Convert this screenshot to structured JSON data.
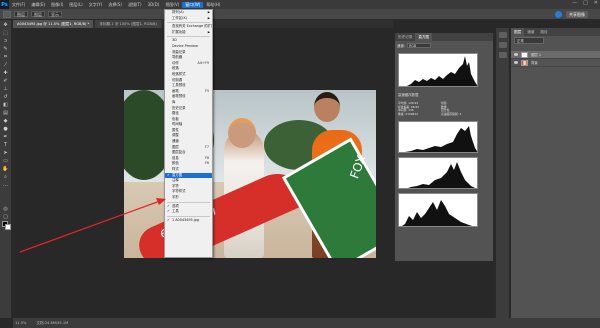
{
  "app": {
    "logo": "Ps",
    "menu_items": [
      "文件(F)",
      "编辑(E)",
      "图像(I)",
      "图层(L)",
      "文字(Y)",
      "选择(S)",
      "滤镜(T)",
      "3D(D)",
      "视图(V)",
      "窗口(W)",
      "帮助(H)"
    ],
    "active_menu_index": 9,
    "window_controls": [
      "—",
      "□",
      "✕"
    ]
  },
  "options_bar": {
    "fields": [
      "图层",
      "图层",
      "显示"
    ],
    "share_label": "共享图像"
  },
  "tabs": [
    {
      "label": "A0043495.jpg @ 11.5% (图层1, RGB/8) *",
      "active": true
    },
    {
      "label": "未标题-1 @ 100% (图层1, RGB/8)",
      "active": false
    }
  ],
  "window_menu": {
    "items": [
      {
        "label": "排列(A)",
        "submenu": true
      },
      {
        "label": "工作区(K)",
        "submenu": true
      },
      {
        "sep": true
      },
      {
        "label": "查找有关 Exchange 的扩展功能...",
        "submenu": false
      },
      {
        "label": "扩展功能",
        "submenu": true
      },
      {
        "sep": true
      },
      {
        "label": "3D",
        "submenu": false
      },
      {
        "label": "Device Preview",
        "submenu": false
      },
      {
        "label": "测量记录",
        "submenu": false
      },
      {
        "label": "导航器",
        "submenu": false
      },
      {
        "label": "动作",
        "shortcut": "Alt+F9"
      },
      {
        "label": "段落",
        "submenu": false
      },
      {
        "label": "段落样式",
        "submenu": false
      },
      {
        "label": "仿制源",
        "submenu": false
      },
      {
        "label": "工具预设",
        "submenu": false
      },
      {
        "label": "画笔",
        "shortcut": "F5"
      },
      {
        "label": "画笔预设",
        "submenu": false
      },
      {
        "label": "库",
        "submenu": false
      },
      {
        "label": "历史记录",
        "submenu": false
      },
      {
        "label": "路径",
        "submenu": false
      },
      {
        "label": "色板",
        "submenu": false
      },
      {
        "label": "时间轴",
        "submenu": false
      },
      {
        "label": "属性",
        "submenu": false
      },
      {
        "label": "调整",
        "submenu": false
      },
      {
        "label": "通道",
        "submenu": false
      },
      {
        "label": "图层",
        "shortcut": "F7"
      },
      {
        "label": "图层复合",
        "submenu": false
      },
      {
        "label": "信息",
        "shortcut": "F8"
      },
      {
        "label": "颜色",
        "shortcut": "F6"
      },
      {
        "label": "样式",
        "submenu": false
      },
      {
        "label": "直方图",
        "checked": true,
        "highlight": true
      },
      {
        "label": "注释",
        "submenu": false
      },
      {
        "label": "字符",
        "submenu": false
      },
      {
        "label": "字符样式",
        "submenu": false
      },
      {
        "label": "字形",
        "submenu": false
      },
      {
        "sep": true
      },
      {
        "label": "选项",
        "checked": true
      },
      {
        "label": "工具",
        "checked": true
      },
      {
        "sep": true
      },
      {
        "label": "1 A0043495.jpg",
        "checked": true
      }
    ]
  },
  "histogram_panel": {
    "tabs": [
      "历史记录",
      "直方图"
    ],
    "active_tab": 1,
    "channel_label": "通道:",
    "channel_value": "RGB",
    "warning": "高速缓存数据",
    "stats_left": [
      "平均值: 128.94",
      "标准偏差: 68.65",
      "中间值: 136",
      "像素: 2109824"
    ],
    "stats_right": [
      "色阶:",
      "数量:",
      "百分位:",
      "高速缓存级别: 4"
    ]
  },
  "layers_panel": {
    "tabs": [
      "图层",
      "通道",
      "路径"
    ],
    "active_tab": 0,
    "mode_label": "正常",
    "layers": [
      {
        "name": "图层 1",
        "selected": true,
        "photo": false
      },
      {
        "name": "背景",
        "selected": false,
        "photo": true
      }
    ]
  },
  "canvas": {
    "board_text_1": "eyelation",
    "board_text_2": "FOX"
  },
  "status_bar": {
    "zoom": "11.5%",
    "doc": "文档:24.8M/45.1M"
  }
}
